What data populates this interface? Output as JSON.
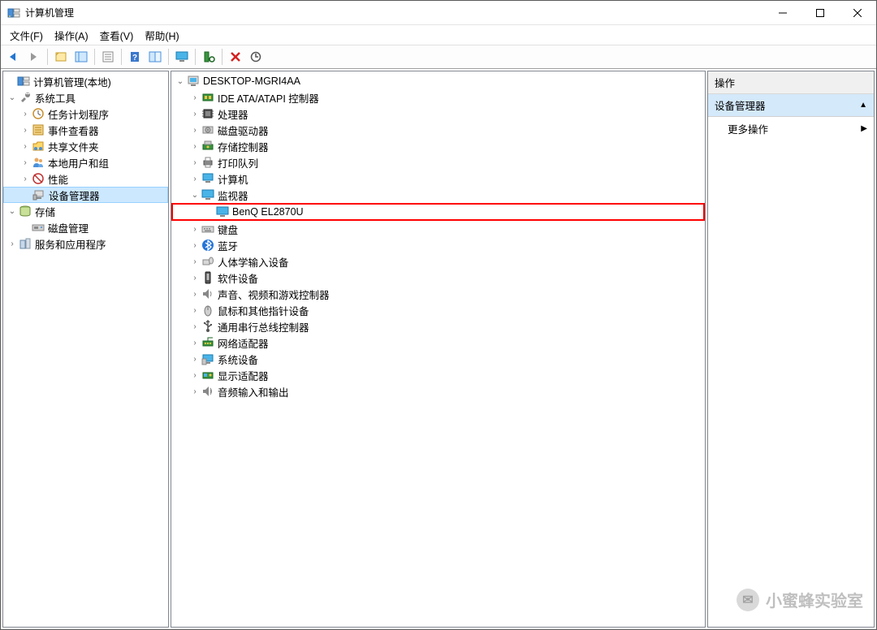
{
  "window": {
    "title": "计算机管理"
  },
  "menu": {
    "file": "文件(F)",
    "action": "操作(A)",
    "view": "查看(V)",
    "help": "帮助(H)"
  },
  "left_tree": {
    "root": "计算机管理(本地)",
    "system_tools": "系统工具",
    "task_scheduler": "任务计划程序",
    "event_viewer": "事件查看器",
    "shared_folders": "共享文件夹",
    "local_users": "本地用户和组",
    "performance": "性能",
    "device_manager": "设备管理器",
    "storage": "存储",
    "disk_management": "磁盘管理",
    "services": "服务和应用程序"
  },
  "center_tree": {
    "root": "DESKTOP-MGRI4AA",
    "ide": "IDE ATA/ATAPI 控制器",
    "cpu": "处理器",
    "disk_drives": "磁盘驱动器",
    "storage_ctrl": "存储控制器",
    "print_queue": "打印队列",
    "computer": "计算机",
    "monitor": "监视器",
    "monitor_item": "BenQ EL2870U",
    "keyboard": "键盘",
    "bluetooth": "蓝牙",
    "hid": "人体学输入设备",
    "software_dev": "软件设备",
    "sound": "声音、视频和游戏控制器",
    "mouse": "鼠标和其他指针设备",
    "usb": "通用串行总线控制器",
    "network": "网络适配器",
    "system_dev": "系统设备",
    "display": "显示适配器",
    "audio_io": "音频输入和输出"
  },
  "right_panel": {
    "header": "操作",
    "section": "设备管理器",
    "more": "更多操作"
  },
  "watermark": {
    "text": "小蜜蜂实验室"
  }
}
